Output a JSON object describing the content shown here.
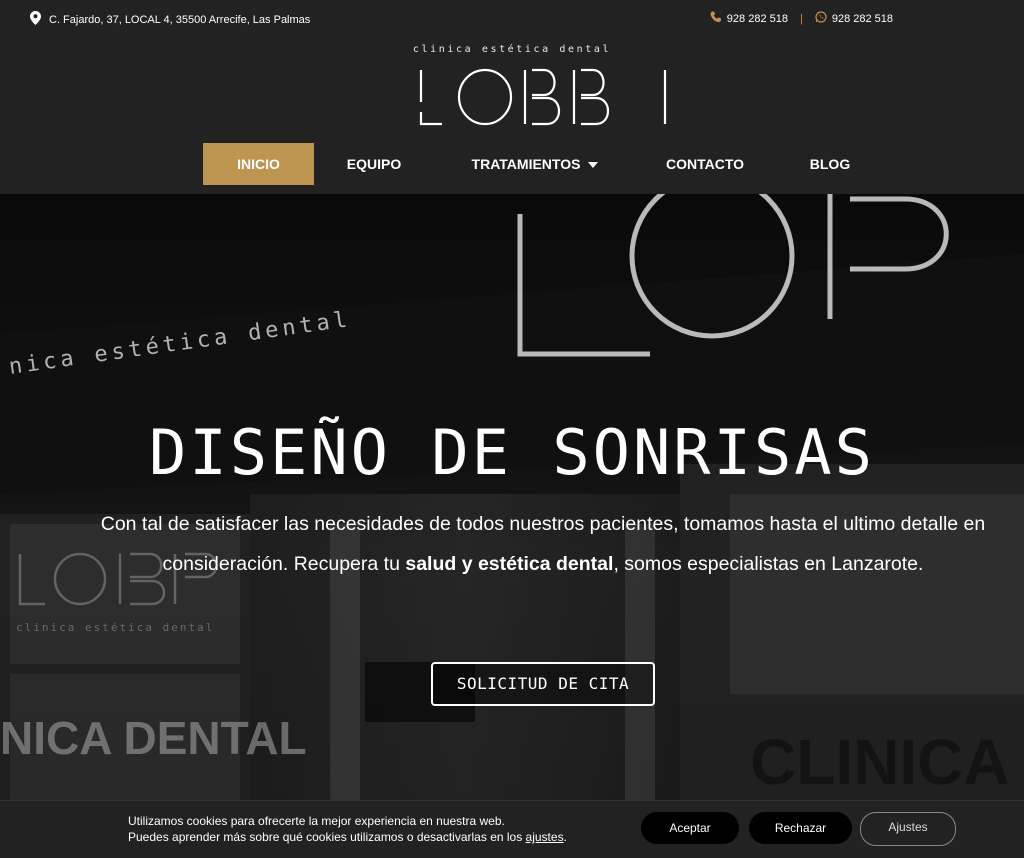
{
  "topbar": {
    "address": "C. Fajardo, 37, LOCAL 4, 35500 Arrecife, Las Palmas",
    "phone": "928 282 518",
    "whatsapp": "928 282 518",
    "separator": "|"
  },
  "header": {
    "tagline": "clinica estética dental",
    "logo_text": "LOBBI"
  },
  "nav": {
    "items": [
      {
        "label": "INICIO"
      },
      {
        "label": "EQUIPO"
      },
      {
        "label": "TRATAMIENTOS"
      },
      {
        "label": "CONTACTO"
      },
      {
        "label": "BLOG"
      }
    ]
  },
  "hero": {
    "title": "DISEÑO DE SONRISAS",
    "text_before": "Con tal de satisfacer las necesidades de todos nuestros pacientes, tomamos hasta el ultimo detalle en consideración. Recupera tu ",
    "text_bold": "salud y estética dental",
    "text_after": ",  somos especialistas en Lanzarote.",
    "cta_label": "SOLICITUD DE CITA"
  },
  "cookie": {
    "line1": "Utilizamos cookies para ofrecerte la mejor experiencia en nuestra web.",
    "line2_prefix": "Puedes aprender más sobre qué cookies utilizamos o desactivarlas en los ",
    "line2_link": "ajustes",
    "line2_suffix": ".",
    "accept_label": "Aceptar",
    "reject_label": "Rechazar",
    "settings_label": "Ajustes"
  },
  "colors": {
    "accent": "#bd9450",
    "background": "#222222"
  },
  "icons": {
    "address": "map-pin-icon",
    "phone": "phone-icon",
    "whatsapp": "whatsapp-icon",
    "dropdown": "caret-down-icon"
  }
}
